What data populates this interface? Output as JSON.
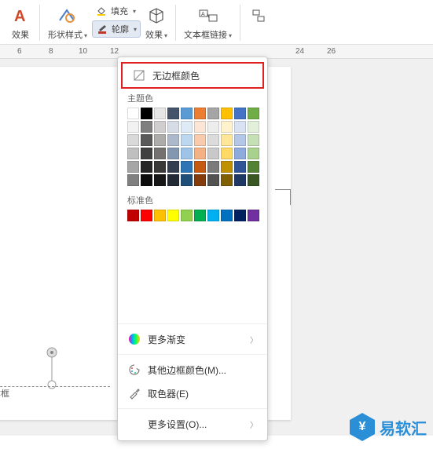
{
  "toolbar": {
    "effect1": "效果",
    "shape_style": "形状样式",
    "fill": "填充",
    "outline": "轮廓",
    "effect2": "效果",
    "textbox_link": "文本框链接"
  },
  "ruler": {
    "r6": "6",
    "r8": "8",
    "r10": "10",
    "r12": "12",
    "r24": "24",
    "r26": "26"
  },
  "canvas": {
    "textbox_label": "本框"
  },
  "menu": {
    "no_border": "无边框颜色",
    "theme_colors": "主题色",
    "standard_colors": "标准色",
    "more_gradient": "更多渐变",
    "other_colors": "其他边框颜色(M)...",
    "eyedropper": "取色器(E)",
    "more_settings": "更多设置(O)..."
  },
  "theme_swatches": [
    "#ffffff",
    "#000000",
    "#e7e6e6",
    "#44546a",
    "#5b9bd5",
    "#ed7d31",
    "#a5a5a5",
    "#ffc000",
    "#4472c4",
    "#70ad47",
    "#f2f2f2",
    "#7f7f7f",
    "#d0cece",
    "#d6dce5",
    "#deebf7",
    "#fbe5d6",
    "#ededed",
    "#fff2cc",
    "#d9e2f3",
    "#e2efda",
    "#d9d9d9",
    "#595959",
    "#aeabab",
    "#adb9ca",
    "#bdd7ee",
    "#f8cbad",
    "#dbdbdb",
    "#ffe699",
    "#b4c7e7",
    "#c5e0b4",
    "#bfbfbf",
    "#404040",
    "#757171",
    "#8497b0",
    "#9dc3e6",
    "#f4b183",
    "#c9c9c9",
    "#ffd966",
    "#8faadc",
    "#a9d18e",
    "#a6a6a6",
    "#262626",
    "#3b3838",
    "#333f50",
    "#2e75b6",
    "#c55a11",
    "#7b7b7b",
    "#bf9000",
    "#2f5597",
    "#548235",
    "#808080",
    "#0d0d0d",
    "#171717",
    "#222a35",
    "#1f4e79",
    "#843c0c",
    "#525252",
    "#806000",
    "#203864",
    "#385723"
  ],
  "standard_swatches": [
    "#c00000",
    "#ff0000",
    "#ffc000",
    "#ffff00",
    "#92d050",
    "#00b050",
    "#00b0f0",
    "#0070c0",
    "#002060",
    "#7030a0"
  ],
  "watermark": "易软汇"
}
